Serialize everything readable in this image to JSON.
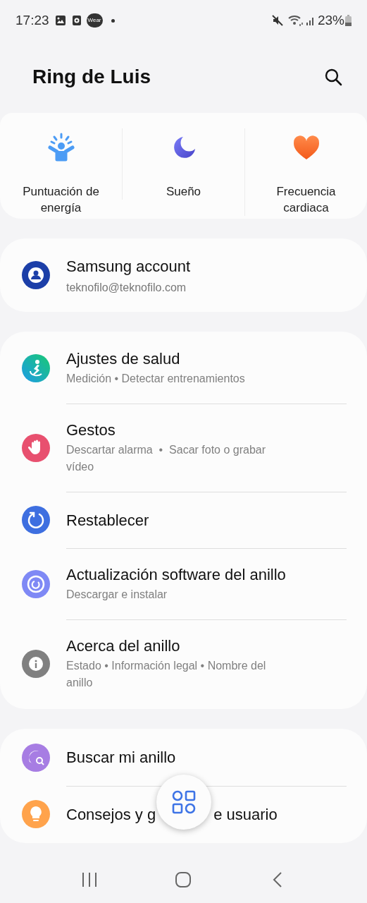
{
  "status_bar": {
    "time": "17:23",
    "wear_badge": "Wear",
    "battery": "23%"
  },
  "header": {
    "title": "Ring de Luis"
  },
  "shortcuts": [
    {
      "label": "Puntuación de energía"
    },
    {
      "label": "Sueño"
    },
    {
      "label": "Frecuencia cardiaca"
    }
  ],
  "account": {
    "title": "Samsung account",
    "subtitle": "teknofilo@teknofilo.com"
  },
  "settings": [
    {
      "title": "Ajustes de salud",
      "subtitle": "Medición • Detectar entrenamientos"
    },
    {
      "title": "Gestos",
      "subtitle": "Descartar alarma  •  Sacar foto o grabar vídeo"
    },
    {
      "title": "Restablecer"
    },
    {
      "title": "Actualización software del anillo",
      "subtitle": "Descargar e instalar"
    },
    {
      "title": "Acerca del anillo",
      "subtitle": "Estado • Información legal • Nombre del anillo"
    }
  ],
  "more": [
    {
      "title": "Buscar mi anillo"
    },
    {
      "title_parts": [
        "Consejos y g",
        "e usuario"
      ]
    }
  ]
}
